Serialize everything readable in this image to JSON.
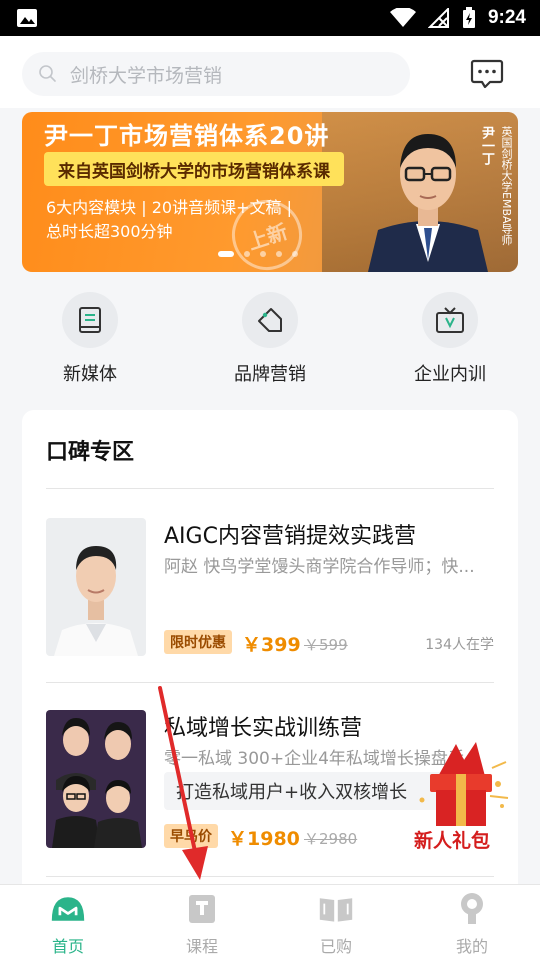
{
  "status": {
    "time": "9:24"
  },
  "search": {
    "placeholder": "剑桥大学市场营销"
  },
  "banner": {
    "title": "尹一丁市场营销体系20讲",
    "subtitle": "来自英国剑桥大学的市场营销体系课",
    "line1": "6大内容模块 | 20讲音频课+文稿 |",
    "line2": "总时长超300分钟",
    "stamp": "上新",
    "vertical_name": "尹一丁",
    "vertical_title": "英国剑桥大学EMBA导师",
    "slides": 5,
    "active_slide": 1
  },
  "categories": [
    {
      "label": "新媒体",
      "icon": "book-icon"
    },
    {
      "label": "品牌营销",
      "icon": "tag-icon"
    },
    {
      "label": "企业内训",
      "icon": "video-icon"
    }
  ],
  "section": {
    "title": "口碑专区"
  },
  "courses": [
    {
      "title": "AIGC内容营销提效实践营",
      "desc": "阿赵 快鸟学堂馒头商学院合作导师；快...",
      "tag": "限时优惠",
      "price": "￥399",
      "old_price": "￥599",
      "learners": "134人在学"
    },
    {
      "title": "私域增长实战训练营",
      "desc": "零一私域 300+企业4年私域增长操盘手",
      "highlight": "打造私域用户+收入双核增长",
      "tag": "早鸟价",
      "price": "￥1980",
      "old_price": "￥2980"
    }
  ],
  "gift": {
    "label": "新人礼包"
  },
  "tabs": [
    {
      "label": "首页",
      "icon": "home-icon",
      "active": true
    },
    {
      "label": "课程",
      "icon": "course-icon",
      "active": false
    },
    {
      "label": "已购",
      "icon": "purchased-icon",
      "active": false
    },
    {
      "label": "我的",
      "icon": "profile-icon",
      "active": false
    }
  ],
  "colors": {
    "accent": "#2bb48a",
    "price": "#ef8c00",
    "banner": "#ff8c1a"
  }
}
